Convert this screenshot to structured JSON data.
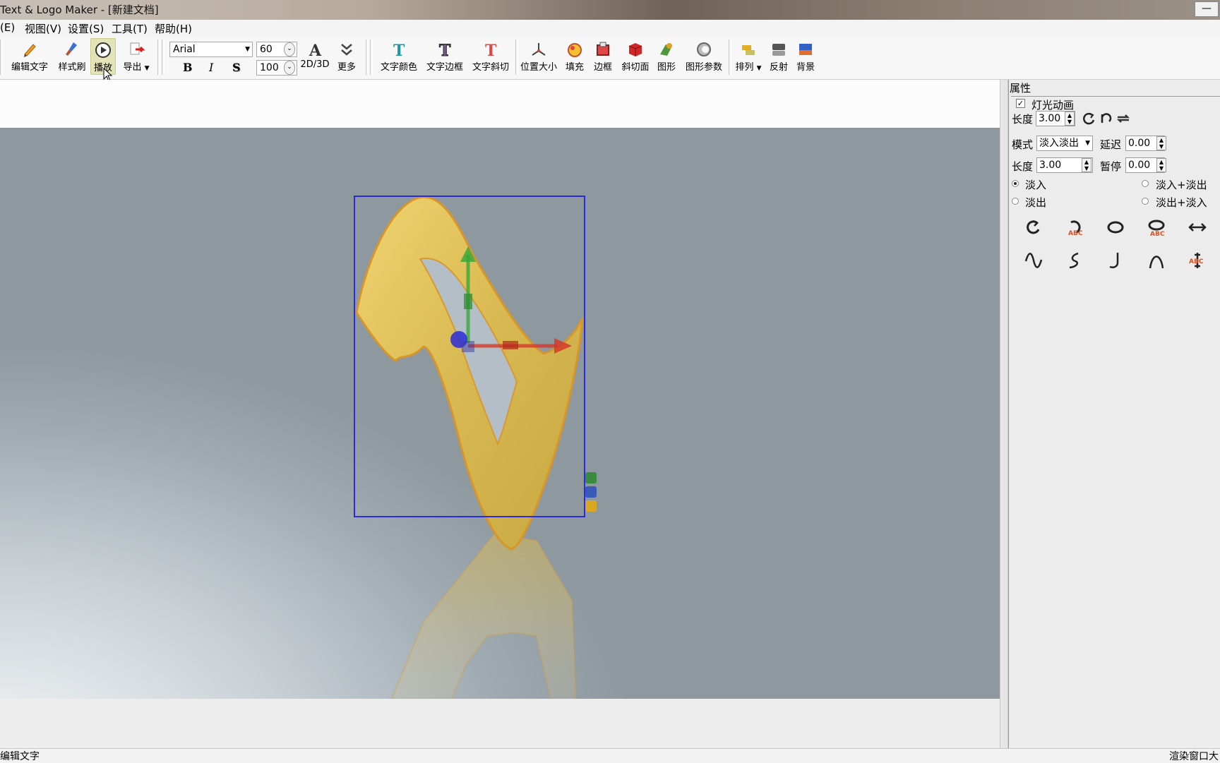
{
  "window": {
    "title": "Text & Logo Maker - [新建文档]",
    "minimize_label": "—"
  },
  "menu": {
    "items": [
      "(E)",
      "视图(V)",
      "设置(S)",
      "工具(T)",
      "帮助(H)"
    ]
  },
  "toolbar": {
    "edit_text": "编辑文字",
    "style_brush": "样式刷",
    "play": "播放",
    "export": "导出",
    "font_name": "Arial",
    "font_size": "60",
    "font_scale": "100",
    "bold": "B",
    "italic": "I",
    "shadow": "S",
    "mode_2d3d": "2D/3D",
    "more": "更多",
    "text_color": "文字颜色",
    "text_border": "文字边框",
    "text_bevel": "文字斜切",
    "position_size": "位置大小",
    "fill": "填充",
    "border": "边框",
    "bevel_face": "斜切面",
    "shape": "图形",
    "shape_params": "图形参数",
    "arrange": "排列",
    "reflect": "反射",
    "background": "背景"
  },
  "properties": {
    "header": "属性",
    "light_animation_label": "灯光动画",
    "light_animation_checked": true,
    "length_label": "长度",
    "length_value": "3.00",
    "mode_label": "模式",
    "mode_value": "淡入淡出",
    "delay_label": "延迟",
    "delay_value": "0.00",
    "length2_label": "长度",
    "length2_value": "3.00",
    "pause_label": "暂停",
    "pause_value": "0.00",
    "radio_fade_in": "淡入",
    "radio_fade_in_out": "淡入+淡出",
    "radio_fade_out": "淡出",
    "radio_fade_out_in": "淡出+淡入",
    "selected_radio": "淡入"
  },
  "status": {
    "left": "编辑文字",
    "right": "渲染窗口大"
  },
  "colors": {
    "gold": "#e3c45a",
    "gold_edge": "#c89020",
    "selection": "#2a2ae0",
    "axis_x": "#d43a2a",
    "axis_y": "#3aa83a",
    "axis_z": "#2a2ad8"
  }
}
